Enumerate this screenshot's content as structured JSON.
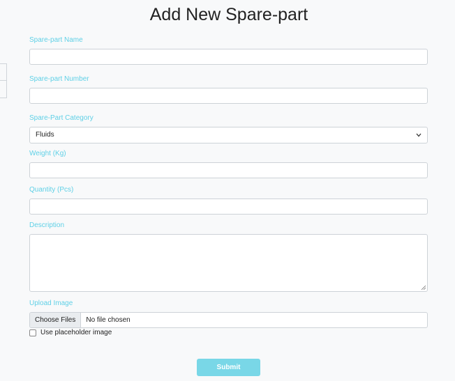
{
  "page": {
    "title": "Add New Spare-part"
  },
  "form": {
    "name_label": "Spare-part Name",
    "name_value": "",
    "number_label": "Spare-part Number",
    "number_value": "",
    "category_label": "Spare-Part Category",
    "category_selected": "Fluids",
    "weight_label": "Weight (Kg)",
    "weight_value": "",
    "quantity_label": "Quantity (Pcs)",
    "quantity_value": "",
    "description_label": "Description",
    "description_value": "",
    "image_label": "Upload Image",
    "choose_files": "Choose Files",
    "file_status": "No file chosen",
    "placeholder_label": "Use placeholder image",
    "placeholder_checked": false,
    "submit": "Submit"
  },
  "colors": {
    "label": "#5fd0e6",
    "submit_bg": "#79d7e7",
    "background": "#f8f9fa"
  },
  "icons": {
    "select": "chevron-down-icon",
    "textarea": "resize-grip-icon"
  }
}
